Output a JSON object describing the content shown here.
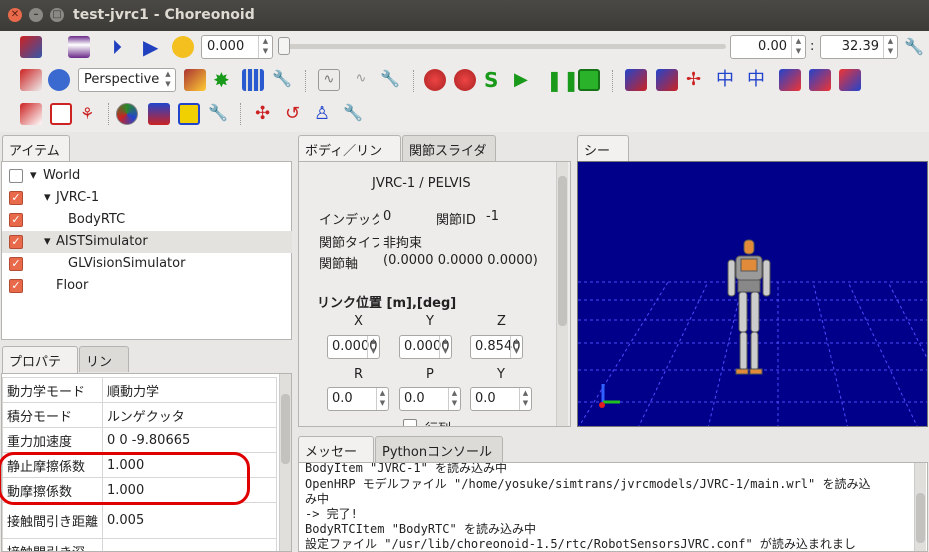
{
  "window": {
    "title": "test-jvrc1 - Choreonoid"
  },
  "toolbar1": {
    "time_value": "0.000",
    "time_start": "0.00",
    "time_end": "32.39"
  },
  "toolbar2": {
    "view_mode": "Perspective"
  },
  "items_panel": {
    "tab": "アイテム",
    "items": [
      {
        "label": "World",
        "checked": false
      },
      {
        "label": "JVRC-1",
        "checked": true
      },
      {
        "label": "BodyRTC",
        "checked": true
      },
      {
        "label": "AISTSimulator",
        "checked": true
      },
      {
        "label": "GLVisionSimulator",
        "checked": true
      },
      {
        "label": "Floor",
        "checked": true
      }
    ]
  },
  "props_panel": {
    "tabs": [
      "プロパティ",
      "リンク"
    ],
    "rows": [
      {
        "k": "動力学モード",
        "v": "順動力学"
      },
      {
        "k": "積分モード",
        "v": "ルンゲクッタ"
      },
      {
        "k": "重力加速度",
        "v": "0  0  -9.80665"
      },
      {
        "k": "静止摩擦係数",
        "v": "1.000"
      },
      {
        "k": "動摩擦係数",
        "v": "1.000"
      },
      {
        "k": "接触間引き距離",
        "v": "0.005"
      },
      {
        "k": "接触間引き深",
        "v": ""
      }
    ]
  },
  "body_panel": {
    "tabs": [
      "ボディ／リンク",
      "関節スライダ"
    ],
    "header": "JVRC-1 / PELVIS",
    "index_label": "インデックス",
    "index_value": "0",
    "joint_id_label": "関節ID",
    "joint_id_value": "-1",
    "joint_type_label": "関節タイプ",
    "joint_type_value": "非拘束",
    "joint_axis_label": "関節軸",
    "joint_axis_value": "(0.0000 0.0000 0.0000)",
    "link_pos_title": "リンク位置 [m],[deg]",
    "xyz_labels": [
      "X",
      "Y",
      "Z"
    ],
    "xyz_values": [
      "0.0000",
      "0.0000",
      "0.8540"
    ],
    "rpy_labels": [
      "R",
      "P",
      "Y"
    ],
    "rpy_values": [
      "0.0",
      "0.0",
      "0.0"
    ],
    "matrix_label": "行列"
  },
  "scene_panel": {
    "tab": "シーン",
    "bg": "#00008b",
    "floor": "#3030c0"
  },
  "message_panel": {
    "tabs": [
      "メッセージ",
      "Pythonコンソール"
    ],
    "lines": [
      "BodyItem \"JVRC-1\" を読み込み中",
      "OpenHRP モデルファイル \"/home/yosuke/simtrans/jvrcmodels/JVRC-1/main.wrl\" を読み込",
      "み中",
      "-> 完了!",
      "BodyRTCItem \"BodyRTC\" を読み込み中",
      "設定ファイル \"/usr/lib/choreonoid-1.5/rtc/RobotSensorsJVRC.conf\" が読み込まれまし"
    ]
  },
  "colors": {
    "highlight": "#e00000",
    "accent": "#e9694b"
  }
}
